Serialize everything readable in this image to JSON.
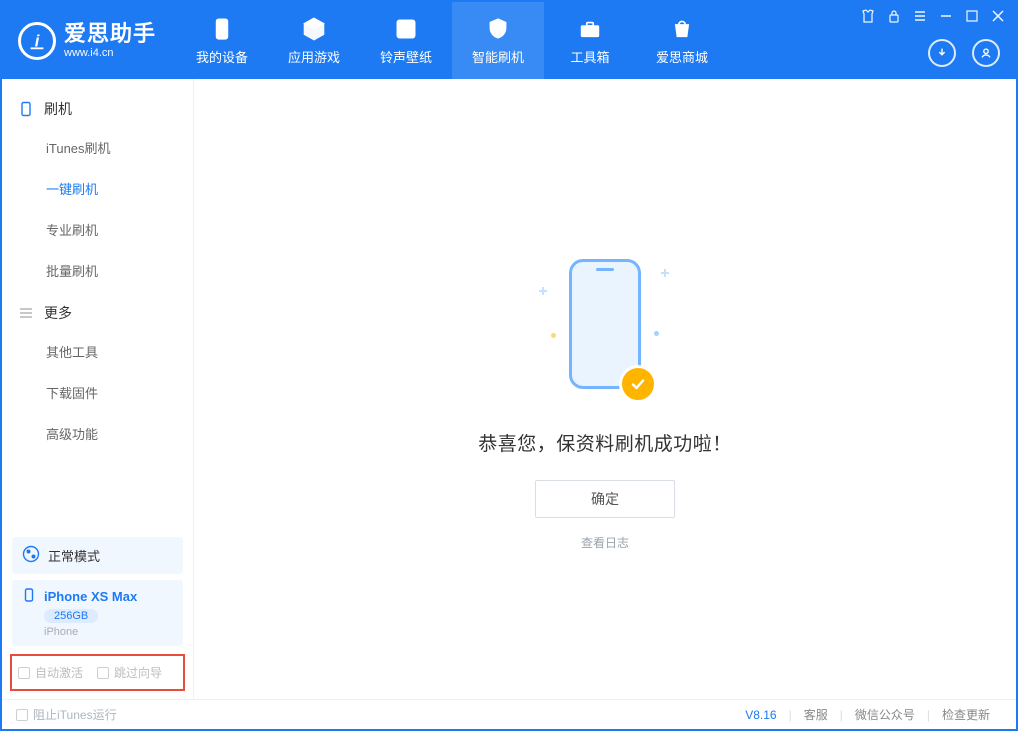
{
  "app": {
    "title": "爱思助手",
    "subtitle": "www.i4.cn"
  },
  "nav": [
    {
      "label": "我的设备"
    },
    {
      "label": "应用游戏"
    },
    {
      "label": "铃声壁纸"
    },
    {
      "label": "智能刷机"
    },
    {
      "label": "工具箱"
    },
    {
      "label": "爱思商城"
    }
  ],
  "sidebar": {
    "group_flash": "刷机",
    "items_flash": [
      "iTunes刷机",
      "一键刷机",
      "专业刷机",
      "批量刷机"
    ],
    "group_more": "更多",
    "items_more": [
      "其他工具",
      "下载固件",
      "高级功能"
    ]
  },
  "mode": {
    "label": "正常模式"
  },
  "device": {
    "name": "iPhone XS Max",
    "storage": "256GB",
    "type": "iPhone"
  },
  "bottom_checks": {
    "auto_activate": "自动激活",
    "skip_guide": "跳过向导"
  },
  "main": {
    "success_title": "恭喜您，保资料刷机成功啦！",
    "ok_button": "确定",
    "view_log": "查看日志"
  },
  "footer": {
    "block_itunes": "阻止iTunes运行",
    "version": "V8.16",
    "support": "客服",
    "wechat": "微信公众号",
    "check_update": "检查更新"
  }
}
